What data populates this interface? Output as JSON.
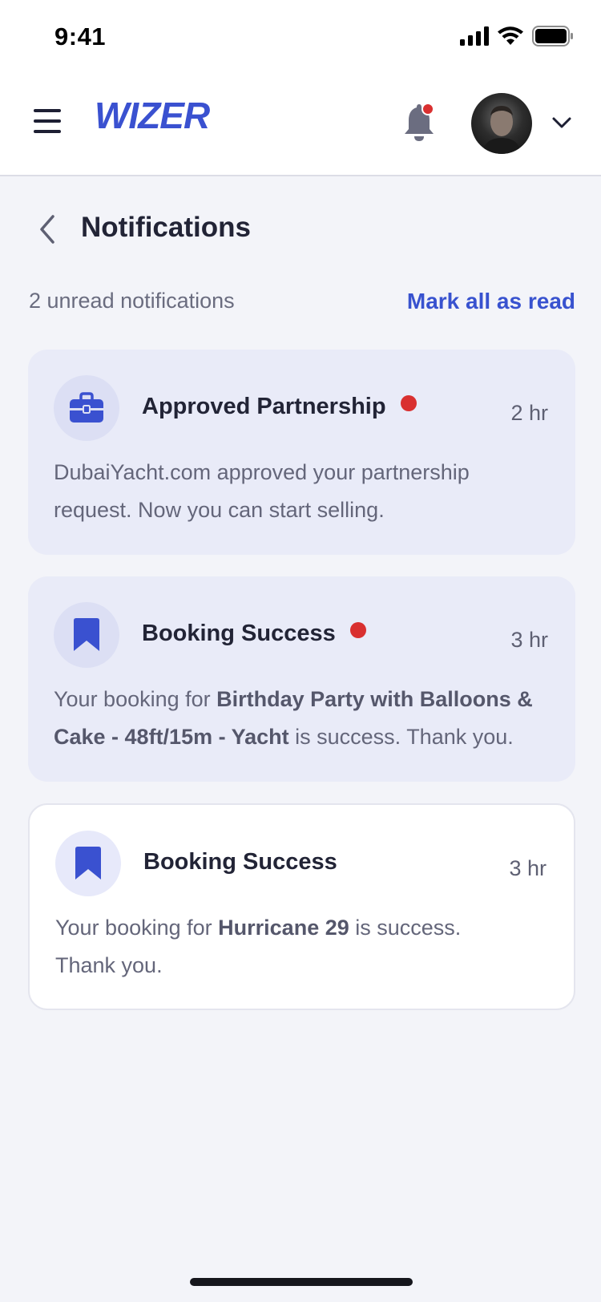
{
  "status_bar": {
    "time": "9:41"
  },
  "header": {
    "brand": "WIZER",
    "brand_color": "#3a51d0",
    "icons": [
      "menu-icon",
      "bell-icon",
      "chevron-down-icon"
    ]
  },
  "page": {
    "title": "Notifications",
    "unread_summary": "2 unread notifications",
    "mark_all_label": "Mark all as read"
  },
  "notifications": [
    {
      "icon": "briefcase-icon",
      "title": "Approved Partnership",
      "unread": true,
      "time": "2 hr",
      "body_parts": [
        "DubaiYacht.com approved your partnership request. Now you can start selling."
      ]
    },
    {
      "icon": "bookmark-icon",
      "title": "Booking Success",
      "unread": true,
      "time": "3 hr",
      "body_prefix": "Your booking for ",
      "body_bold": "Birthday Party with Balloons & Cake - 48ft/15m - Yacht",
      "body_suffix": " is success. Thank you."
    },
    {
      "icon": "bookmark-icon",
      "title": "Booking Success",
      "unread": false,
      "time": "3 hr",
      "body_prefix": "Your booking for ",
      "body_bold": "Hurricane 29",
      "body_suffix": " is success. Thank you."
    }
  ],
  "colors": {
    "accent": "#3852cf",
    "unread_dot": "#d93030",
    "unread_card_bg": "#e9ebf8",
    "read_card_bg": "#ffffff"
  }
}
